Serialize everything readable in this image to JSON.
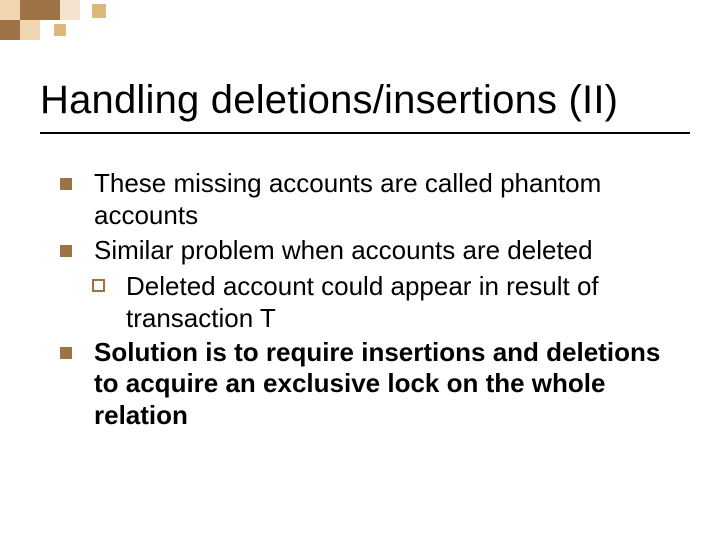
{
  "colors": {
    "accent_dark": "#9d7345",
    "accent_lightest": "#f4e4cf",
    "accent_mid": "#e0b77b",
    "accent_light": "#f0d6b0"
  },
  "title": "Handling deletions/insertions (II)",
  "bullets": [
    {
      "text": "These missing accounts are called phantom accounts",
      "bold": false,
      "children": []
    },
    {
      "text": "Similar problem when accounts are deleted",
      "bold": false,
      "children": [
        {
          "text": "Deleted account could appear in result of transaction T",
          "bold": false
        }
      ]
    },
    {
      "text": "Solution is to require insertions and deletions to acquire an exclusive lock on the whole relation",
      "bold": true,
      "children": []
    }
  ]
}
